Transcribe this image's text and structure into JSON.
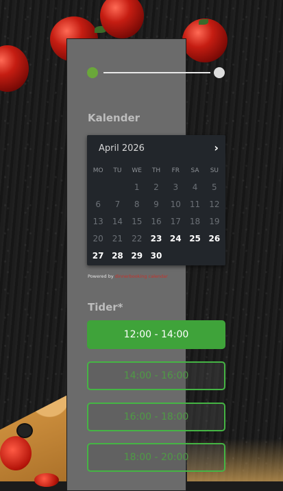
{
  "progress": {
    "current_step": 1,
    "total_steps": 2
  },
  "calendar_section": {
    "title": "Kalender"
  },
  "calendar": {
    "month_label": "April 2026",
    "next_symbol": "›",
    "weekdays": [
      "MO",
      "TU",
      "WE",
      "TH",
      "FR",
      "SA",
      "SU"
    ],
    "days": [
      {
        "label": "",
        "available": false
      },
      {
        "label": "",
        "available": false
      },
      {
        "label": "1",
        "available": false
      },
      {
        "label": "2",
        "available": false
      },
      {
        "label": "3",
        "available": false
      },
      {
        "label": "4",
        "available": false
      },
      {
        "label": "5",
        "available": false
      },
      {
        "label": "6",
        "available": false
      },
      {
        "label": "7",
        "available": false
      },
      {
        "label": "8",
        "available": false
      },
      {
        "label": "9",
        "available": false
      },
      {
        "label": "10",
        "available": false
      },
      {
        "label": "11",
        "available": false
      },
      {
        "label": "12",
        "available": false
      },
      {
        "label": "13",
        "available": false
      },
      {
        "label": "14",
        "available": false
      },
      {
        "label": "15",
        "available": false
      },
      {
        "label": "16",
        "available": false
      },
      {
        "label": "17",
        "available": false
      },
      {
        "label": "18",
        "available": false
      },
      {
        "label": "19",
        "available": false
      },
      {
        "label": "20",
        "available": false
      },
      {
        "label": "21",
        "available": false
      },
      {
        "label": "22",
        "available": false
      },
      {
        "label": "23",
        "available": true
      },
      {
        "label": "24",
        "available": true
      },
      {
        "label": "25",
        "available": true
      },
      {
        "label": "26",
        "available": true
      },
      {
        "label": "27",
        "available": true
      },
      {
        "label": "28",
        "available": true
      },
      {
        "label": "29",
        "available": true
      },
      {
        "label": "30",
        "available": true
      }
    ],
    "powered_prefix": "Powered by",
    "powered_brand": "dinnerbooking calendar"
  },
  "times_section": {
    "title": "Tider*"
  },
  "time_slots": [
    {
      "label": "12:00 - 14:00",
      "selected": true
    },
    {
      "label": "14:00 - 16:00",
      "selected": false
    },
    {
      "label": "16:00 - 18:00",
      "selected": false
    },
    {
      "label": "18:00 - 20:00",
      "selected": false
    }
  ],
  "colors": {
    "accent_green": "#3fa33a",
    "progress_active": "#6aa73a",
    "panel_bg": "#6b6b6b",
    "calendar_bg": "#22262b",
    "brand_red": "#c8312a"
  }
}
